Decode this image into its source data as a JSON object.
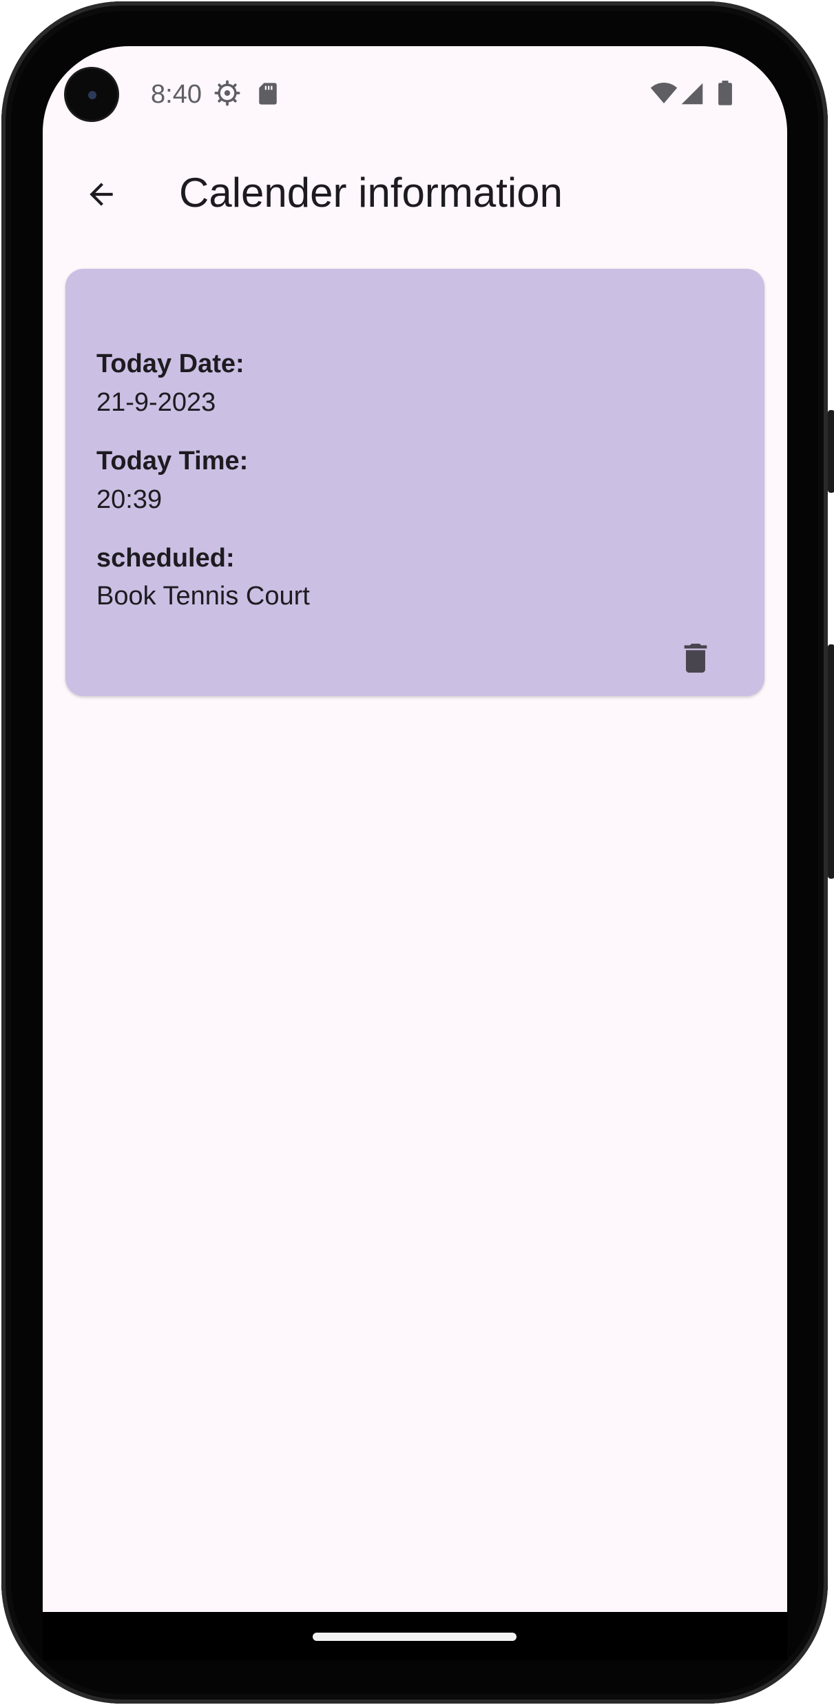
{
  "status_bar": {
    "time": "8:40",
    "icons": [
      "gear-icon",
      "sd-card-icon",
      "wifi-icon",
      "signal-icon",
      "battery-icon"
    ]
  },
  "app_bar": {
    "back_icon": "arrow-back-icon",
    "title": "Calender information"
  },
  "card": {
    "background_color": "#cbbfe3",
    "fields": [
      {
        "label": "Today Date:",
        "value": "21-9-2023"
      },
      {
        "label": "Today Time:",
        "value": "20:39"
      },
      {
        "label": "scheduled:",
        "value": "Book Tennis Court"
      }
    ],
    "delete_icon": "trash-icon"
  },
  "colors": {
    "screen_background": "#fef7fb",
    "text_primary": "#1d1b20",
    "icon_dark": "#49454f"
  }
}
